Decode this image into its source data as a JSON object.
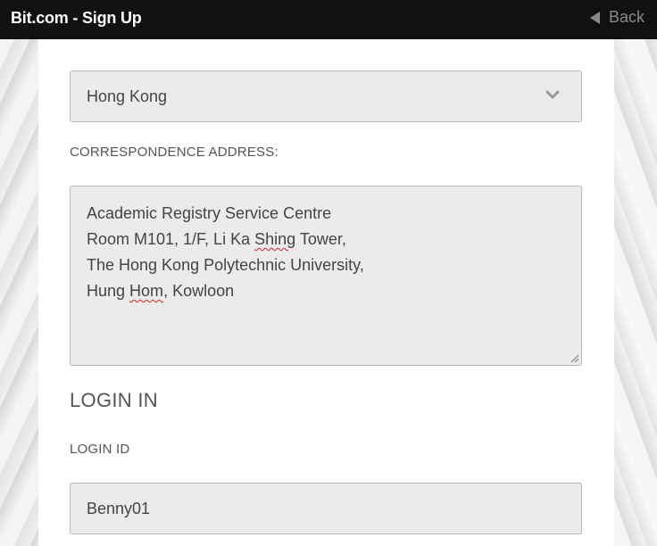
{
  "header": {
    "title": "Bit.com - Sign Up",
    "back_label": "Back"
  },
  "form": {
    "country": {
      "selected": "Hong Kong"
    },
    "correspondence_address": {
      "label": "CORRESPONDENCE ADDRESS:",
      "lines": [
        [
          "Academic Registry Service Centre"
        ],
        [
          "Room M101, 1/F, Li Ka ",
          "Shing",
          " Tower,"
        ],
        [
          "The Hong Kong Polytechnic University,"
        ],
        [
          "Hung ",
          "Hom",
          ", Kowloon"
        ]
      ]
    },
    "login_section": {
      "heading": "LOGIN IN",
      "login_id_label": "LOGIN ID",
      "login_id_value": "Benny01"
    }
  },
  "colors": {
    "topbar": "#111111",
    "field_bg": "#ebebeb",
    "field_border": "#b8b8b8",
    "text": "#444444",
    "spellcheck_underline": "#dd2222"
  }
}
